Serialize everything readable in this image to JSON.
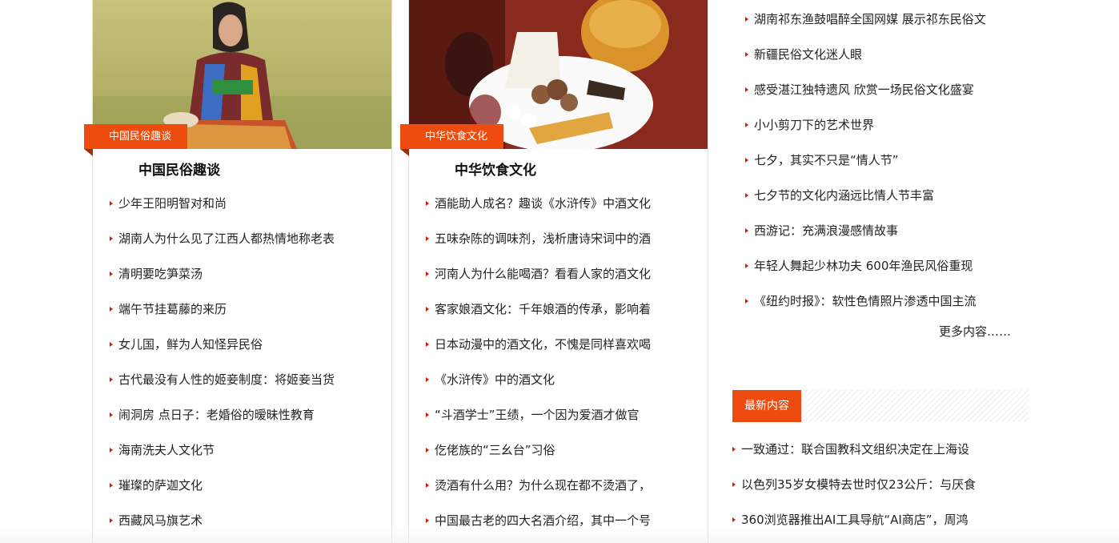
{
  "folk": {
    "tag": "中国民俗趣谈",
    "title": "中国民俗趣谈",
    "items": [
      "少年王阳明智对和尚",
      "湖南人为什么见了江西人都热情地称老表",
      "清明要吃笋菜汤",
      "端午节挂葛藤的来历",
      "女儿国，鲜为人知怪异民俗",
      "古代最没有人性的姬妾制度：将姬妾当货",
      "闹洞房 点日子：老婚俗的暧昧性教育",
      "海南洗夫人文化节",
      "璀璨的萨迦文化",
      "西藏风马旗艺术"
    ]
  },
  "food": {
    "tag": "中华饮食文化",
    "title": "中华饮食文化",
    "items": [
      "酒能助人成名？趣谈《水浒传》中酒文化",
      "五味杂陈的调味剂，浅析唐诗宋词中的酒",
      "河南人为什么能喝酒？看看人家的酒文化",
      "客家娘酒文化：千年娘酒的传承，影响着",
      "日本动漫中的酒文化，不愧是同样喜欢喝",
      "《水浒传》中的酒文化",
      "“斗酒学士”王绩，一个因为爱酒才做官",
      "仡佬族的“三幺台”习俗",
      "烫酒有什么用？为什么现在都不烫酒了，",
      "中国最古老的四大名酒介绍，其中一个号"
    ]
  },
  "right": {
    "items": [
      "湖南祁东渔鼓唱醉全国网媒 展示祁东民俗文",
      "新疆民俗文化迷人眼",
      "感受湛江独特遗风 欣赏一场民俗文化盛宴",
      "小小剪刀下的艺术世界",
      "七夕，其实不只是“情人节”",
      "七夕节的文化内涵远比情人节丰富",
      "西游记：充满浪漫感情故事",
      "年轻人舞起少林功夫 600年渔民风俗重现",
      "《纽约时报》：软性色情照片渗透中国主流"
    ],
    "more": "更多内容……"
  },
  "latest": {
    "tag": "最新内容",
    "items": [
      "一致通过：联合国教科文组织决定在上海设",
      "以色列35岁女模特去世时仅23公斤：与厌食",
      "360浏览器推出AI工具导航“AI商店”，周鸿"
    ]
  },
  "colors": {
    "accent": "#ee4b0f",
    "bullet": "#d21a0a"
  }
}
